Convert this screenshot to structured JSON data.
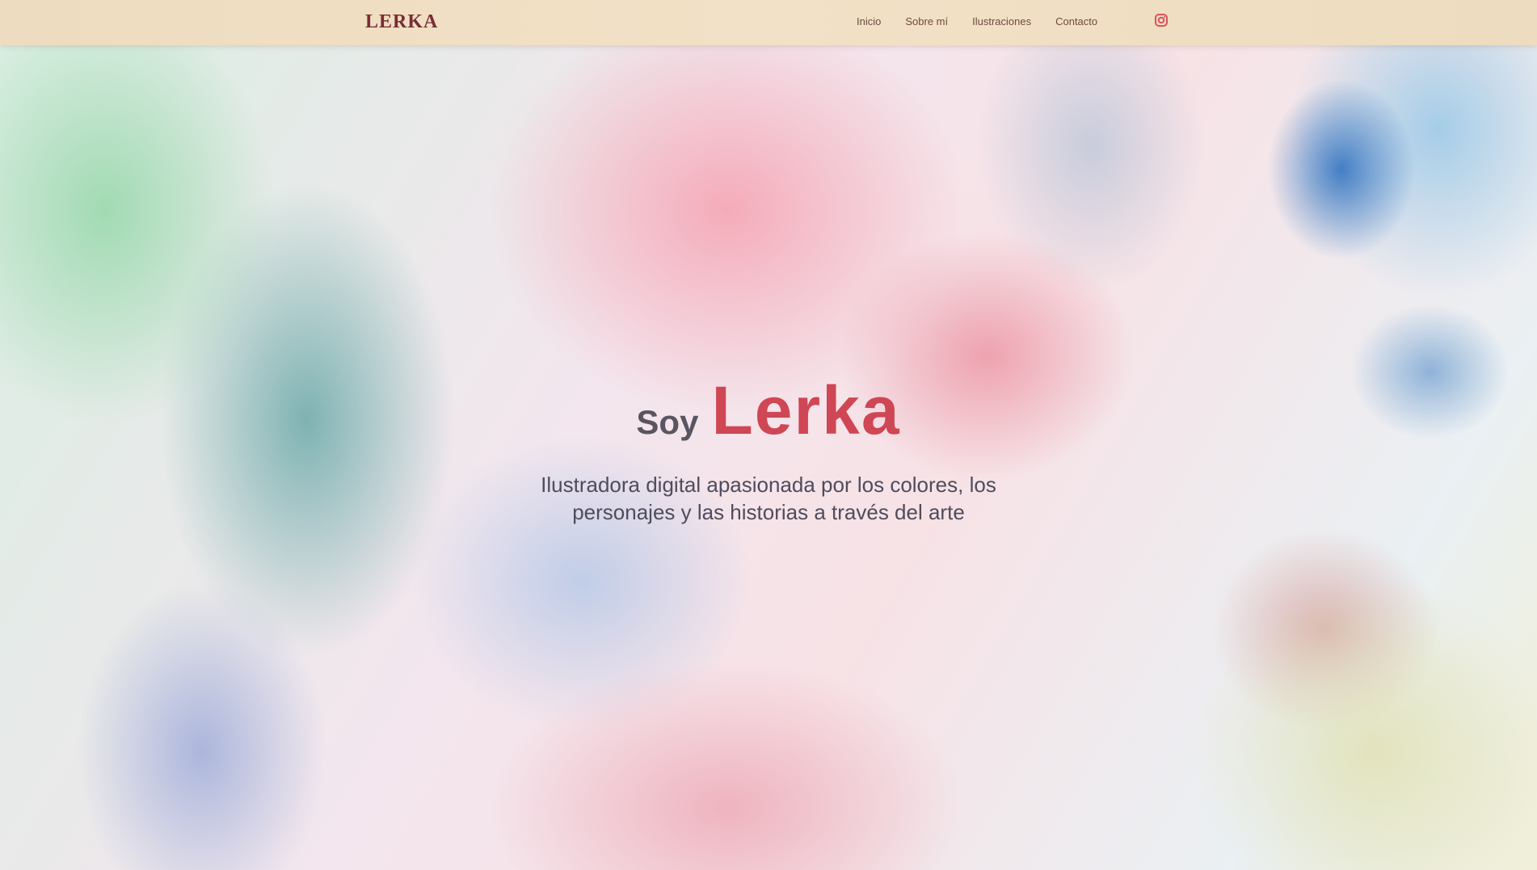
{
  "navbar": {
    "logo": "LERKA",
    "links": [
      {
        "label": "Inicio"
      },
      {
        "label": "Sobre mí"
      },
      {
        "label": "Ilustraciones"
      },
      {
        "label": "Contacto"
      }
    ],
    "icon": "instagram-icon",
    "accent_color": "#cf4654"
  },
  "hero": {
    "greeting": "Soy",
    "name": "Lerka",
    "subtitle": "Ilustradora digital apasionada por los colores, los personajes y las historias a través del arte"
  },
  "colors": {
    "navbar_bg": "#f2e1c6",
    "name": "#cf4654",
    "text": "#4f4c5c"
  }
}
